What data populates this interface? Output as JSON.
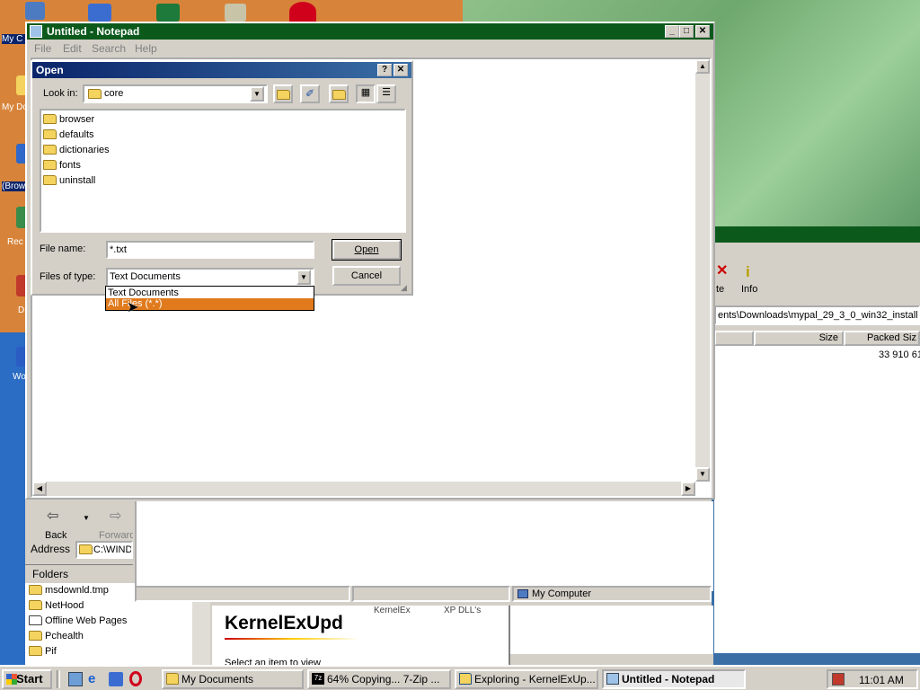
{
  "desktop": {
    "icons": [
      {
        "label": "My C",
        "color": "#4d7bc1",
        "icon": "my-computer-icon"
      },
      {
        "label": "My Do",
        "color": "#f4d35e",
        "icon": "my-documents-icon"
      },
      {
        "label": "(Brow",
        "color": "#3a7bd5",
        "icon": "browser-icon"
      },
      {
        "label": "Rec",
        "color": "#3a8c4a",
        "icon": "recycle-bin-icon"
      },
      {
        "label": "D",
        "color": "#c0392b",
        "icon": "app-icon"
      },
      {
        "label": "Wo",
        "color": "#2b5cc4",
        "icon": "word-icon"
      }
    ],
    "top_icons": [
      {
        "icon": "outlook-icon",
        "color": "#3b6dd1"
      },
      {
        "icon": "excel-icon",
        "color": "#1d7a3a"
      },
      {
        "icon": "scheduler-icon",
        "color": "#c0c0a0"
      },
      {
        "icon": "opera-icon",
        "color": "#d0021b"
      }
    ]
  },
  "notepad": {
    "title": "Untitled - Notepad",
    "menu": [
      "File",
      "Edit",
      "Search",
      "Help"
    ]
  },
  "open_dialog": {
    "title": "Open",
    "look_in_label": "Look in:",
    "look_in_value": "core",
    "files": [
      "browser",
      "defaults",
      "dictionaries",
      "fonts",
      "uninstall"
    ],
    "file_name_label": "File name:",
    "file_name_value": "*.txt",
    "files_of_type_label": "Files of type:",
    "files_of_type_value": "Text Documents",
    "type_options": [
      "Text Documents",
      "All Files (*.*)"
    ],
    "open_button": "Open",
    "cancel_button": "Cancel"
  },
  "sevenzip": {
    "toolbar": [
      {
        "label": "te",
        "icon": "delete-icon"
      },
      {
        "label": "Info",
        "icon": "info-icon"
      }
    ],
    "path": "ents\\Downloads\\mypal_29_3_0_win32_installer",
    "columns": [
      "Size",
      "Packed Siz"
    ],
    "row_value": "33 910 61"
  },
  "explorer": {
    "back_label": "Back",
    "forward_label": "Forward",
    "address_label": "Address",
    "address_value": "C:\\WIND",
    "folders_label": "Folders",
    "tree": [
      "msdownld.tmp",
      "NetHood",
      "Offline Web Pages",
      "Pchealth",
      "Pif"
    ],
    "status_location": "My Computer",
    "webview_title": "KernelExUpd",
    "webview_hint": "Select an item to view",
    "col_frag_1": "KernelEx",
    "col_frag_2": "XP DLL's"
  },
  "taskbar": {
    "start_label": "Start",
    "tasks": [
      {
        "label": "My Documents",
        "icon": "folder-icon"
      },
      {
        "label": "64% Copying... 7-Zip ...",
        "icon": "7zip-icon"
      },
      {
        "label": "Exploring - KernelExUp...",
        "icon": "explorer-icon"
      },
      {
        "label": "Untitled - Notepad",
        "icon": "notepad-icon",
        "active": true
      }
    ],
    "clock": "11:01 AM"
  }
}
